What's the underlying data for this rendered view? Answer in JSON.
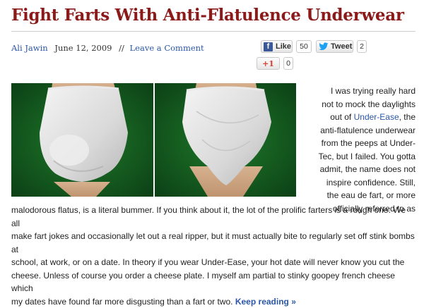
{
  "post": {
    "title": "Fight Farts With Anti-Flatulence Underwear",
    "author": "Ali Jawin",
    "date": "June 12, 2009",
    "separator": "//",
    "comment_link": "Leave a Comment"
  },
  "social": {
    "facebook": {
      "label": "Like",
      "count": "50"
    },
    "twitter": {
      "label": "Tweet",
      "count": "2"
    },
    "gplus": {
      "label": "+1",
      "count": "0"
    }
  },
  "image": {
    "alt_icon": "underwear-photo"
  },
  "article": {
    "right_lines": [
      "I was trying really hard",
      "not to mock the daylights",
      "out of",
      "Under-Ease",
      ", the",
      "anti-flatulence underwear",
      "from the peeps at Under-",
      "Tec, but I failed. You gotta",
      "admit, the name does not",
      "inspire confidence. Still,",
      "the eau de fart, or more",
      "officially referred to as"
    ],
    "full_lines": [
      "malodorous flatus, is a literal bummer. If you think about it, the lot of the prolific farters is a rough one. We all",
      "make fart jokes and occasionally let out a real ripper, but it must actually bite to regularly set off stink bombs at",
      "school, at work, or on a date. In theory if you wear Under-Ease, your hot date will never know you cut the",
      "cheese. Unless of course you order a cheese plate. I myself am partial to stinky goopey french cheese which",
      "my dates have found far more disgusting than a fart or two."
    ],
    "keep_reading": "Keep reading »"
  }
}
